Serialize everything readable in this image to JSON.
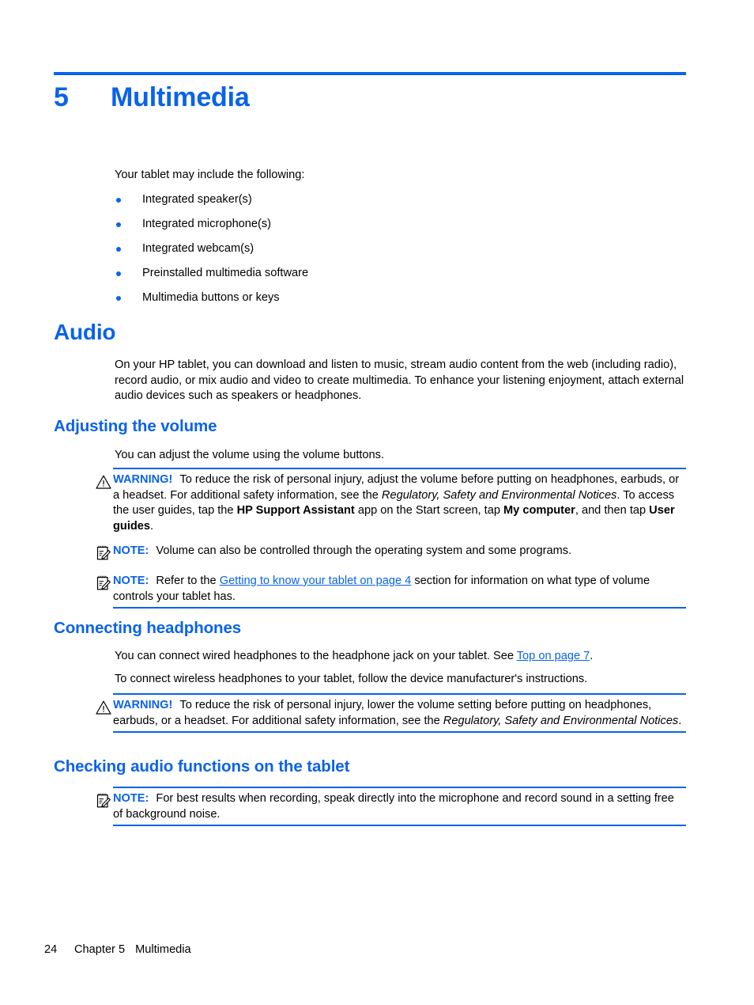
{
  "chapter": {
    "number": "5",
    "title": "Multimedia"
  },
  "intro": {
    "lead": "Your tablet may include the following:",
    "bullets": [
      "Integrated speaker(s)",
      "Integrated microphone(s)",
      "Integrated webcam(s)",
      "Preinstalled multimedia software",
      "Multimedia buttons or keys"
    ]
  },
  "audio": {
    "heading": "Audio",
    "paragraph": "On your HP tablet, you can download and listen to music, stream audio content from the web (including radio), record audio, or mix audio and video to create multimedia. To enhance your listening enjoyment, attach external audio devices such as speakers or headphones."
  },
  "adjusting_volume": {
    "heading": "Adjusting the volume",
    "paragraph": "You can adjust the volume using the volume buttons.",
    "warning": {
      "label": "WARNING!",
      "text_1": "To reduce the risk of personal injury, adjust the volume before putting on headphones, earbuds, or a headset. For additional safety information, see the ",
      "italic_1": "Regulatory, Safety and Environmental Notices",
      "text_2": ". To access the user guides, tap the ",
      "bold_1": "HP Support Assistant",
      "text_3": " app on the Start screen, tap ",
      "bold_2": "My computer",
      "text_4": ", and then tap ",
      "bold_3": "User guides",
      "text_5": "."
    },
    "note_1": {
      "label": "NOTE:",
      "text": "Volume can also be controlled through the operating system and some programs."
    },
    "note_2": {
      "label": "NOTE:",
      "text_1": "Refer to the ",
      "link": "Getting to know your tablet on page 4",
      "text_2": " section for information on what type of volume controls your tablet has."
    }
  },
  "connecting_headphones": {
    "heading": "Connecting headphones",
    "paragraph_1_text_1": "You can connect wired headphones to the headphone jack on your tablet. See ",
    "paragraph_1_link": "Top on page 7",
    "paragraph_1_text_2": ".",
    "paragraph_2": "To connect wireless headphones to your tablet, follow the device manufacturer's instructions.",
    "warning": {
      "label": "WARNING!",
      "text_1": "To reduce the risk of personal injury, lower the volume setting before putting on headphones, earbuds, or a headset. For additional safety information, see the ",
      "italic_1": "Regulatory, Safety and Environmental Notices",
      "text_2": "."
    }
  },
  "checking_audio": {
    "heading": "Checking audio functions on the tablet",
    "note": {
      "label": "NOTE:",
      "text": "For best results when recording, speak directly into the microphone and record sound in a setting free of background noise."
    }
  },
  "footer": {
    "page_number": "24",
    "chapter_label": "Chapter 5",
    "chapter_title": "Multimedia"
  },
  "colors": {
    "accent_blue": "#0a63e8",
    "text_black": "#000000"
  }
}
